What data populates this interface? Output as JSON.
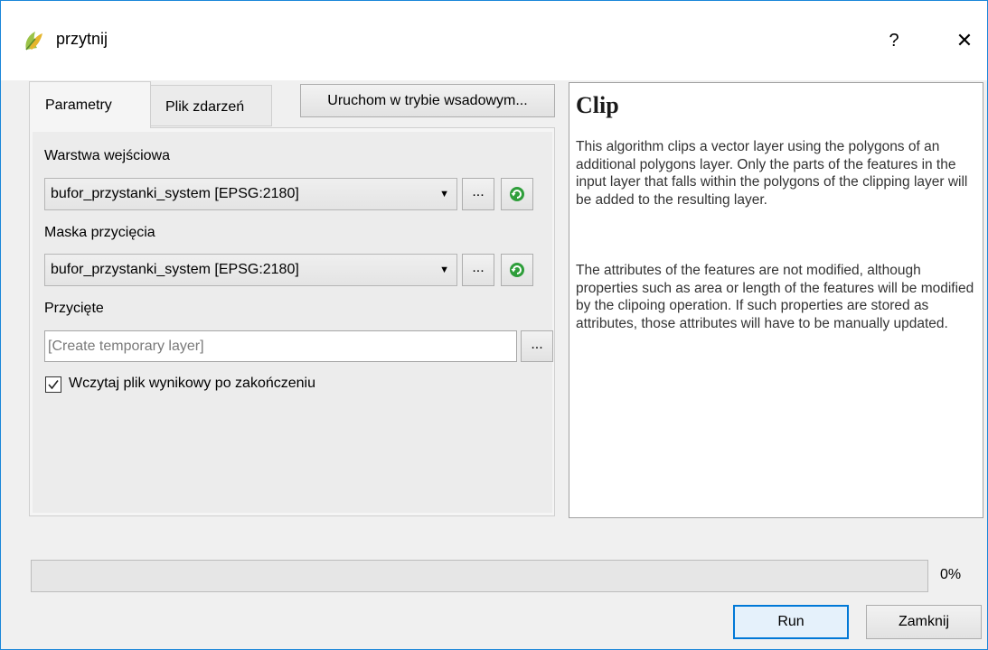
{
  "window": {
    "title": "przytnij",
    "help_glyph": "?",
    "close_glyph": "✕"
  },
  "tabs": [
    {
      "label": "Parametry",
      "active": true
    },
    {
      "label": "Plik zdarzeń",
      "active": false
    }
  ],
  "batch_button": {
    "label": "Uruchom w trybie wsadowym..."
  },
  "params": {
    "input_layer": {
      "label": "Warstwa wejściowa",
      "value": "bufor_przystanki_system [EPSG:2180]",
      "browse_label": "..."
    },
    "clip_mask": {
      "label": "Maska przycięcia",
      "value": "bufor_przystanki_system [EPSG:2180]",
      "browse_label": "..."
    },
    "output": {
      "label": "Przycięte",
      "placeholder": "[Create temporary layer]",
      "browse_label": "..."
    },
    "load_result": {
      "label": "Wczytaj plik wynikowy po zakończeniu",
      "checked": true
    }
  },
  "help": {
    "title": "Clip",
    "paragraph1": "This algorithm clips a vector layer using the polygons of an additional polygons layer. Only the parts of the features in the input layer that falls within the polygons of the clipping layer will be added to the resulting layer.",
    "paragraph2": "The attributes of the features are not modified, although properties such as area or length of the features will be modified by the clipoing operation. If such properties are stored as attributes, those attributes will have to be manually updated."
  },
  "progress": {
    "value": 0,
    "text": "0%"
  },
  "buttons": {
    "run": "Run",
    "close": "Zamknij"
  },
  "colors": {
    "accent": "#0078d7",
    "window_border": "#1a86d9",
    "refresh_icon": "#2e9e3a"
  }
}
